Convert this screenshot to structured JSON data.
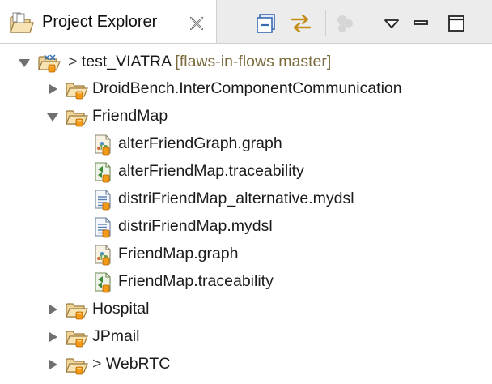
{
  "view": {
    "title": "Project Explorer",
    "toolbar": [
      "collapse-all-icon",
      "link-with-editor-icon",
      "focus-active-task-icon",
      "view-menu-icon",
      "minimize-icon",
      "maximize-icon"
    ]
  },
  "tree": {
    "project": {
      "dirty_marker": ">",
      "name": "test_VIATRA",
      "git": "[flaws-in-flows master]"
    },
    "folders": [
      {
        "name": "DroidBench.InterComponentCommunication",
        "expanded": false
      },
      {
        "name": "FriendMap",
        "expanded": true
      },
      {
        "name": "Hospital",
        "expanded": false
      },
      {
        "name": "JPmail",
        "expanded": false
      },
      {
        "name": "WebRTC",
        "expanded": false,
        "dirty_marker": ">"
      }
    ],
    "friendmap_files": [
      {
        "name": "alterFriendGraph.graph",
        "icon": "graph-file-icon"
      },
      {
        "name": "alterFriendMap.traceability",
        "icon": "traceability-file-icon"
      },
      {
        "name": "distriFriendMap_alternative.mydsl",
        "icon": "text-file-icon"
      },
      {
        "name": "distriFriendMap.mydsl",
        "icon": "text-file-icon"
      },
      {
        "name": "FriendMap.graph",
        "icon": "graph-file-icon"
      },
      {
        "name": "FriendMap.traceability",
        "icon": "traceability-file-icon"
      }
    ]
  }
}
